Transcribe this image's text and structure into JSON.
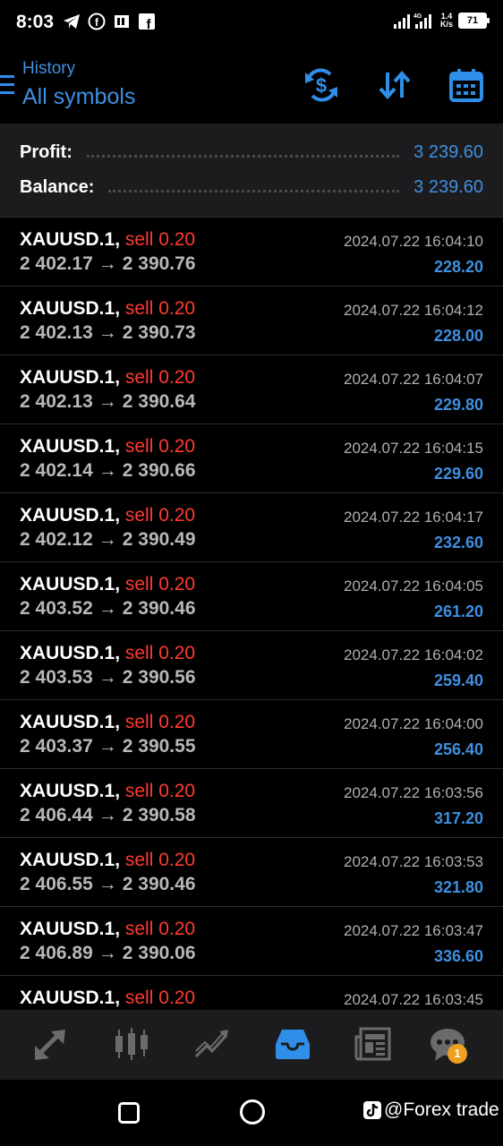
{
  "status_bar": {
    "time": "8:03",
    "network_speed_top": "1.4",
    "network_speed_bottom": "K/s",
    "network_type": "4G",
    "battery": "71"
  },
  "header": {
    "subtitle": "History",
    "title": "All symbols"
  },
  "summary": {
    "profit_label": "Profit:",
    "profit_value": "3 239.60",
    "balance_label": "Balance:",
    "balance_value": "3 239.60"
  },
  "trades": [
    {
      "symbol": "XAUUSD.1,",
      "side": "sell 0.20",
      "open": "2 402.17",
      "close": "2 390.76",
      "datetime": "2024.07.22 16:04:10",
      "profit": "228.20"
    },
    {
      "symbol": "XAUUSD.1,",
      "side": "sell 0.20",
      "open": "2 402.13",
      "close": "2 390.73",
      "datetime": "2024.07.22 16:04:12",
      "profit": "228.00"
    },
    {
      "symbol": "XAUUSD.1,",
      "side": "sell 0.20",
      "open": "2 402.13",
      "close": "2 390.64",
      "datetime": "2024.07.22 16:04:07",
      "profit": "229.80"
    },
    {
      "symbol": "XAUUSD.1,",
      "side": "sell 0.20",
      "open": "2 402.14",
      "close": "2 390.66",
      "datetime": "2024.07.22 16:04:15",
      "profit": "229.60"
    },
    {
      "symbol": "XAUUSD.1,",
      "side": "sell 0.20",
      "open": "2 402.12",
      "close": "2 390.49",
      "datetime": "2024.07.22 16:04:17",
      "profit": "232.60"
    },
    {
      "symbol": "XAUUSD.1,",
      "side": "sell 0.20",
      "open": "2 403.52",
      "close": "2 390.46",
      "datetime": "2024.07.22 16:04:05",
      "profit": "261.20"
    },
    {
      "symbol": "XAUUSD.1,",
      "side": "sell 0.20",
      "open": "2 403.53",
      "close": "2 390.56",
      "datetime": "2024.07.22 16:04:02",
      "profit": "259.40"
    },
    {
      "symbol": "XAUUSD.1,",
      "side": "sell 0.20",
      "open": "2 403.37",
      "close": "2 390.55",
      "datetime": "2024.07.22 16:04:00",
      "profit": "256.40"
    },
    {
      "symbol": "XAUUSD.1,",
      "side": "sell 0.20",
      "open": "2 406.44",
      "close": "2 390.58",
      "datetime": "2024.07.22 16:03:56",
      "profit": "317.20"
    },
    {
      "symbol": "XAUUSD.1,",
      "side": "sell 0.20",
      "open": "2 406.55",
      "close": "2 390.46",
      "datetime": "2024.07.22 16:03:53",
      "profit": "321.80"
    },
    {
      "symbol": "XAUUSD.1,",
      "side": "sell 0.20",
      "open": "2 406.89",
      "close": "2 390.06",
      "datetime": "2024.07.22 16:03:47",
      "profit": "336.60"
    },
    {
      "symbol": "XAUUSD.1,",
      "side": "sell 0.20",
      "open": "",
      "close": "",
      "datetime": "2024.07.22 16:03:45",
      "profit": ""
    }
  ],
  "price_arrow": "→",
  "tab_bar": {
    "items": [
      "quotes-icon",
      "chart-icon",
      "trade-icon",
      "history-icon",
      "news-icon",
      "chat-icon"
    ],
    "active": "history-icon",
    "chat_badge": "1"
  },
  "watermark": "@Forex trade",
  "colors": {
    "accent": "#3f8fe0",
    "sell": "#ff3b30",
    "background": "#000000",
    "panel": "#1c1c1e"
  }
}
